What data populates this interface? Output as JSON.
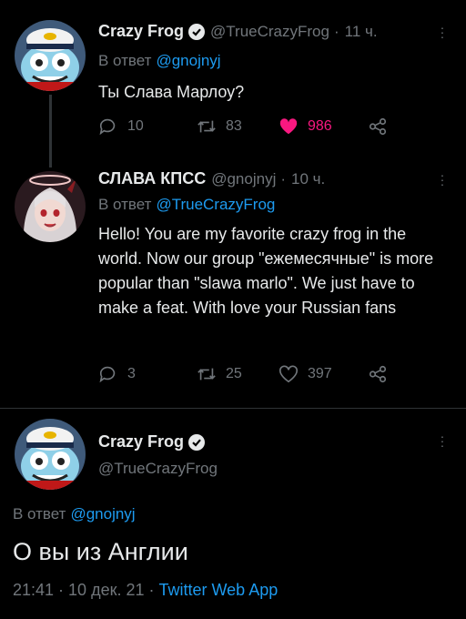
{
  "tweets": [
    {
      "author_name": "Crazy Frog",
      "handle": "@TrueCrazyFrog",
      "time": "11 ч.",
      "reply_prefix": "В ответ",
      "reply_to": "@gnojnyj",
      "text": "Ты Слава Марлоу?",
      "replies": "10",
      "retweets": "83",
      "likes": "986",
      "liked": true
    },
    {
      "author_name": "СЛАВА КПСС",
      "handle": "@gnojnyj",
      "time": "10 ч.",
      "reply_prefix": "В ответ",
      "reply_to": "@TrueCrazyFrog",
      "text": "Hello! You are my favorite crazy frog in the world. Now our group \"ежемесячные\" is more popular than \"slawa marlo\". We just have to make a feat. With love your Russian fans",
      "replies": "3",
      "retweets": "25",
      "likes": "397",
      "liked": false
    }
  ],
  "main_tweet": {
    "author_name": "Crazy Frog",
    "handle": "@TrueCrazyFrog",
    "reply_prefix": "В ответ",
    "reply_to": "@gnojnyj",
    "text": "О вы из Англии",
    "timestamp": "21:41 · 10 дек. 21 ·",
    "source": "Twitter Web App"
  },
  "colors": {
    "accent": "#1d9bf0",
    "like": "#f91880",
    "muted": "#71767b",
    "bg": "#000000"
  },
  "icons": [
    "verified-badge-icon",
    "reply-icon",
    "retweet-icon",
    "like-icon",
    "share-icon",
    "more-icon"
  ]
}
